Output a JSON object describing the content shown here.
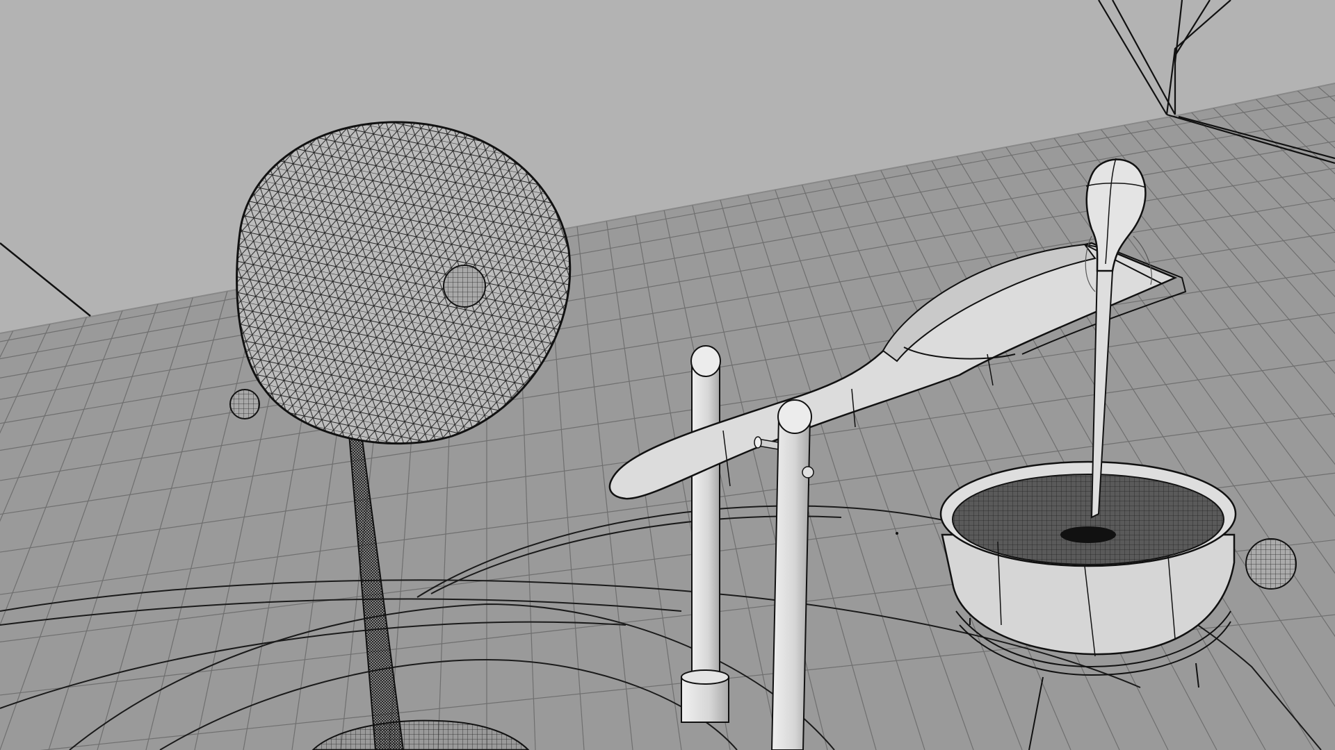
{
  "scene": {
    "kind": "wireframe-3d-viewport",
    "background_color": "#b3b3b3",
    "floor_color": "#9a9a9a",
    "line_color": "#1a1a1a",
    "surface_color": "#d8d8d8",
    "objects": [
      "back-wall",
      "floor-grid",
      "orbit-rings",
      "large-mesh-sphere",
      "small-moon-sphere",
      "tiny-sphere-left",
      "tiny-sphere-right",
      "tapered-stand",
      "spoon-arm",
      "support-post-left",
      "support-post-right",
      "pestle",
      "mesh-bowl",
      "camera-frustum"
    ]
  }
}
